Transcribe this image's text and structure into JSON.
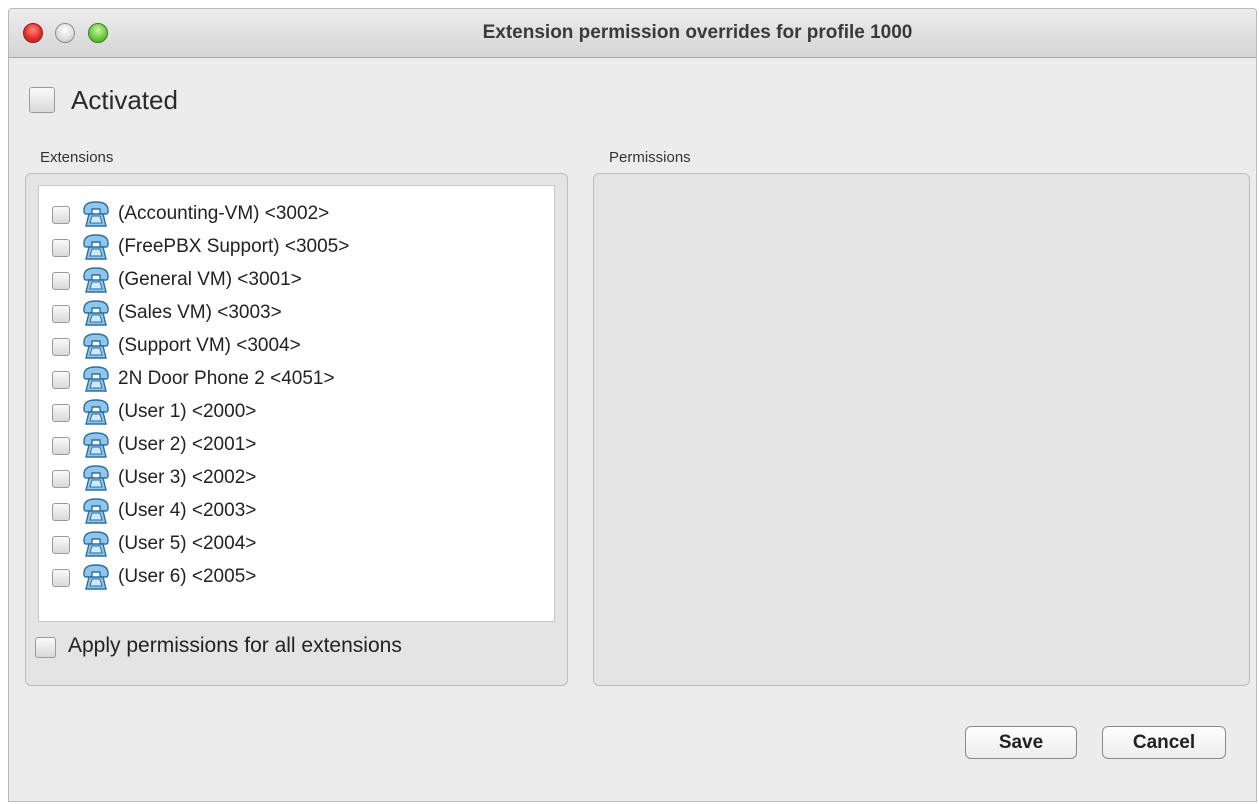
{
  "window": {
    "title": "Extension permission overrides for profile 1000"
  },
  "activated": {
    "label": "Activated",
    "checked": false
  },
  "extensions": {
    "section_label": "Extensions",
    "items": [
      {
        "label": "(Accounting-VM) <3002>",
        "checked": false,
        "icon": "phone-icon"
      },
      {
        "label": "(FreePBX Support) <3005>",
        "checked": false,
        "icon": "phone-icon"
      },
      {
        "label": "(General VM) <3001>",
        "checked": false,
        "icon": "phone-icon"
      },
      {
        "label": "(Sales VM) <3003>",
        "checked": false,
        "icon": "phone-icon"
      },
      {
        "label": "(Support VM) <3004>",
        "checked": false,
        "icon": "phone-icon"
      },
      {
        "label": "2N Door Phone 2 <4051>",
        "checked": false,
        "icon": "phone-icon"
      },
      {
        "label": "(User 1) <2000>",
        "checked": false,
        "icon": "phone-icon"
      },
      {
        "label": "(User 2) <2001>",
        "checked": false,
        "icon": "phone-icon"
      },
      {
        "label": "(User 3) <2002>",
        "checked": false,
        "icon": "phone-icon"
      },
      {
        "label": "(User 4) <2003>",
        "checked": false,
        "icon": "phone-icon"
      },
      {
        "label": "(User 5) <2004>",
        "checked": false,
        "icon": "phone-icon"
      },
      {
        "label": "(User 6) <2005>",
        "checked": false,
        "icon": "phone-icon"
      }
    ],
    "apply_all_label": "Apply permissions for all extensions",
    "apply_all_checked": false
  },
  "permissions": {
    "section_label": "Permissions"
  },
  "buttons": {
    "save": "Save",
    "cancel": "Cancel"
  }
}
